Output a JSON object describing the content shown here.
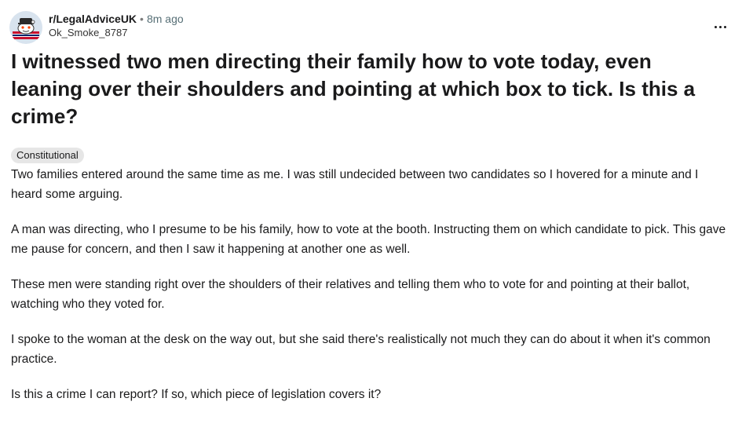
{
  "post": {
    "subreddit": "r/LegalAdviceUK",
    "separator": "•",
    "time_ago": "8m ago",
    "author": "Ok_Smoke_8787",
    "more_icon": "more-horizontal-icon",
    "title": "I witnessed two men directing their family how to vote today, even leaning over their shoulders and pointing at which box to tick. Is this a crime?",
    "flair": "Constitutional",
    "paragraphs": [
      "Two families entered around the same time as me. I was still undecided between two candidates so I hovered for a minute and I heard some arguing.",
      "A man was directing, who I presume to be his family, how to vote at the booth. Instructing them on which candidate to pick. This gave me pause for concern, and then I saw it happening at another one as well.",
      "These men were standing right over the shoulders of their relatives and telling them who to vote for and pointing at their ballot, watching who they voted for.",
      "I spoke to the woman at the desk on the way out, but she said there's realistically not much they can do about it when it's common practice.",
      "Is this a crime I can report? If so, which piece of legislation covers it?"
    ]
  },
  "colors": {
    "text": "#1a1a1b",
    "meta": "#576f76",
    "flair_bg": "#e6e6e6"
  }
}
